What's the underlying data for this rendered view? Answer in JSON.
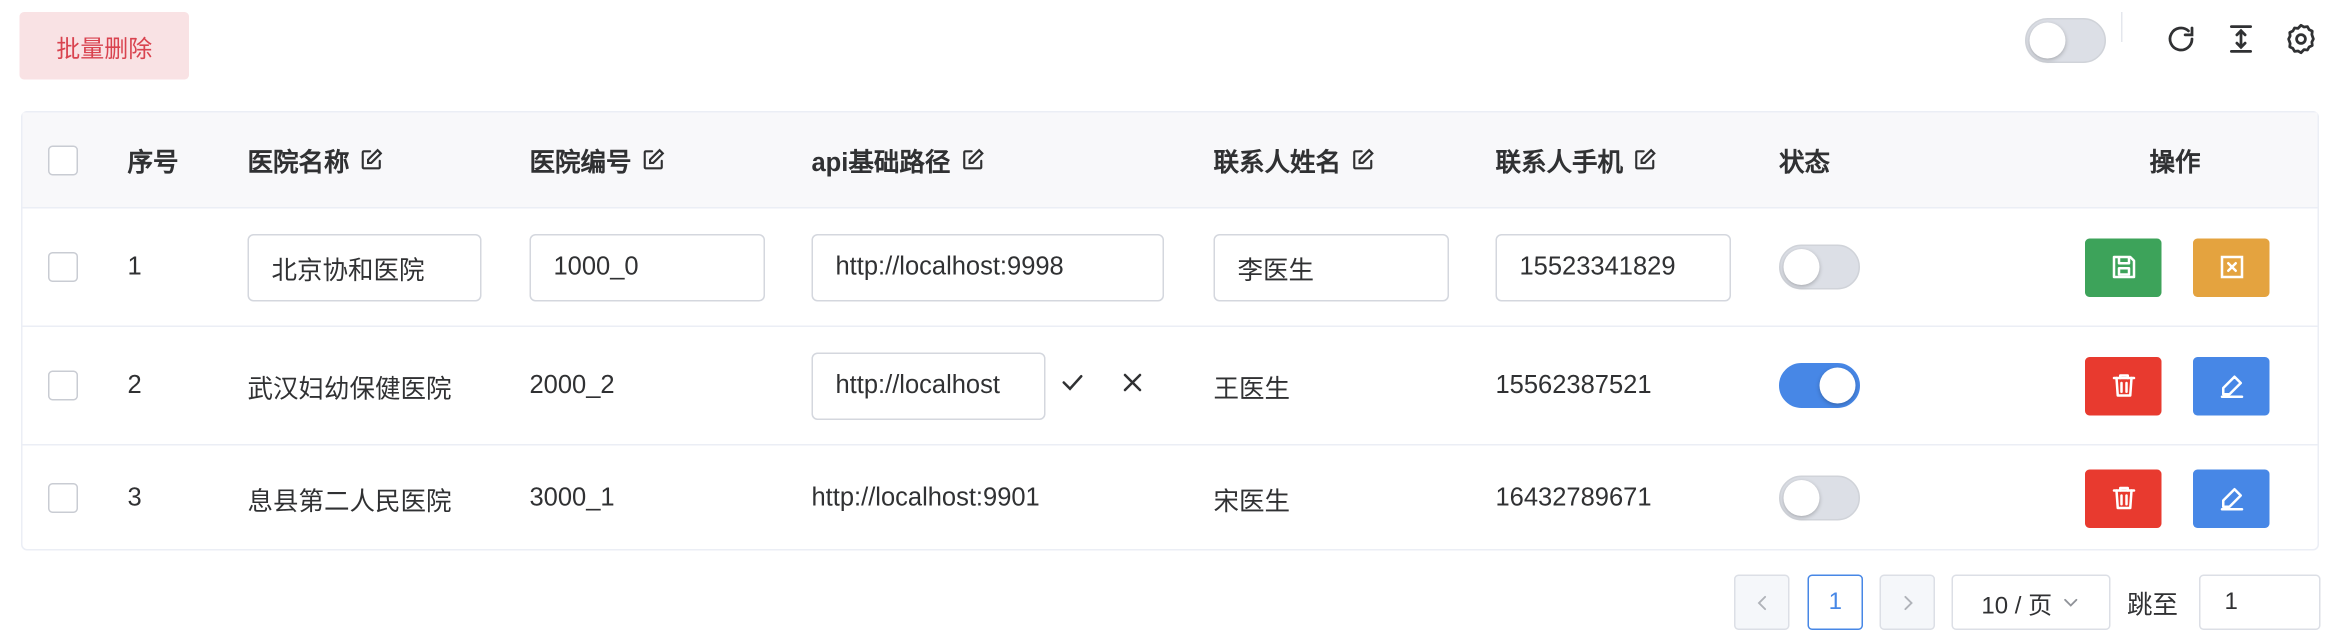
{
  "toolbar": {
    "batch_delete_label": "批量删除",
    "master_switch_on": false,
    "icons": [
      "refresh-icon",
      "column-height-icon",
      "settings-icon"
    ]
  },
  "table": {
    "columns": [
      {
        "label": "序号",
        "editable": false
      },
      {
        "label": "医院名称",
        "editable": true
      },
      {
        "label": "医院编号",
        "editable": true
      },
      {
        "label": "api基础路径",
        "editable": true
      },
      {
        "label": "联系人姓名",
        "editable": true
      },
      {
        "label": "联系人手机",
        "editable": true
      },
      {
        "label": "状态",
        "editable": false
      },
      {
        "label": "操作",
        "editable": false
      }
    ],
    "rows": [
      {
        "index": "1",
        "hospital_name": "北京协和医院",
        "hospital_code": "1000_0",
        "api_base_url": "http://localhost:9998",
        "contact_name": "李医生",
        "contact_phone": "15523341829",
        "status_on": false,
        "mode": "row-editing",
        "actions": [
          "save",
          "cancel"
        ]
      },
      {
        "index": "2",
        "hospital_name": "武汉妇幼保健医院",
        "hospital_code": "2000_2",
        "api_base_url": "http://localhost",
        "contact_name": "王医生",
        "contact_phone": "15562387521",
        "status_on": true,
        "mode": "cell-editing-api",
        "actions": [
          "delete",
          "edit"
        ]
      },
      {
        "index": "3",
        "hospital_name": "息县第二人民医院",
        "hospital_code": "3000_1",
        "api_base_url": "http://localhost:9901",
        "contact_name": "宋医生",
        "contact_phone": "16432789671",
        "status_on": false,
        "mode": "view",
        "actions": [
          "delete",
          "edit"
        ]
      }
    ]
  },
  "pagination": {
    "current_page": "1",
    "page_size_label": "10 / 页",
    "jump_label": "跳至",
    "jump_value": "1"
  },
  "colors": {
    "primary": "#4787e6",
    "danger": "#e83a2f",
    "success": "#3da35a",
    "warning": "#e4a33f",
    "danger_light_bg": "#f9e2e4"
  }
}
